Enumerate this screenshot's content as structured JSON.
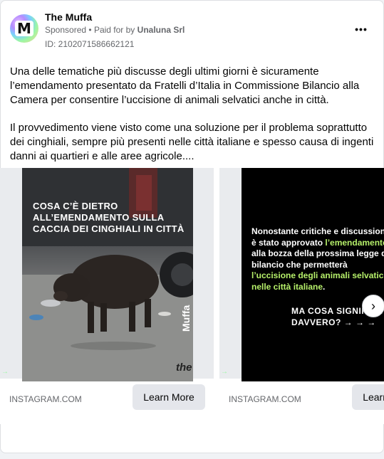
{
  "post": {
    "page_name": "The Muffa",
    "avatar_letter": "M",
    "sponsored_label": "Sponsored",
    "separator": "•",
    "paid_for_prefix": "Paid for by",
    "paid_for_name": "Unaluna Srl",
    "ad_id": "ID: 2102071586662121",
    "more_icon": "more-horizontal-icon",
    "more_label": "•••",
    "paragraph_1": "Una delle tematiche più discusse degli ultimi giorni è sicuramente l’emendamento presentato da Fratelli d’Italia in Commissione Bilancio alla Camera per consentire l’uccisione di animali selvatici anche in città.",
    "paragraph_2": "Il provvedimento viene visto come una soluzione per il problema soprattutto dei cinghiali, sempre più presenti nelle città italiane e spesso causa di ingenti danni ai quartieri e alle aree agricole...."
  },
  "carousel": {
    "next_icon": "chevron-right-icon",
    "next_label": "›",
    "cards": [
      {
        "headline": "COSA C’È DIETRO ALL’EMENDAMENTO SULLA CACCIA DEI CINGHIALI IN CITTÀ",
        "watermark_muffa": "Muffa",
        "watermark_the": "the",
        "arrow": "→",
        "source": "INSTAGRAM.COM",
        "button_label": "Learn More"
      },
      {
        "text_1": "Nonostante critiche e discussioni, è stato approvato ",
        "highlight_1": "l’emendamento",
        "text_2": " alla bozza della prossima legge di bilancio che permetterà ",
        "highlight_2": "l’uccisione degli animali selvatici nelle città italiane",
        "text_3": ".",
        "cta": "MA COSA SIGNIFICA DAVVERO? → → →",
        "arrow": "→",
        "source": "INSTAGRAM.COM",
        "button_label": "Learn More"
      }
    ]
  },
  "colors": {
    "accent_green": "#b6f06a",
    "text_secondary": "#65676b",
    "button_bg": "#e4e6eb"
  }
}
